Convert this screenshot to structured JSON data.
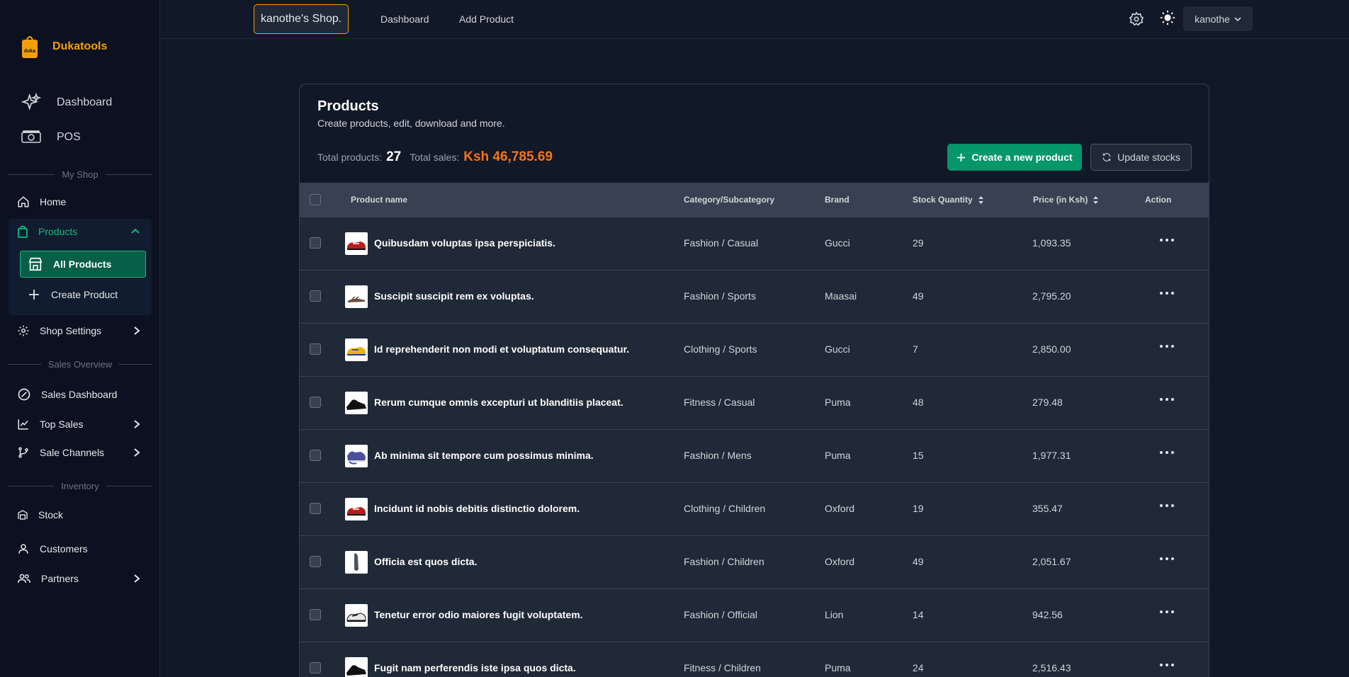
{
  "sidebar": {
    "brand": "Dukatools",
    "brand_logo_text": "duka",
    "nav_top": [
      {
        "label": "Dashboard",
        "icon": "sparkles-icon"
      },
      {
        "label": "POS",
        "icon": "cash-icon"
      }
    ],
    "sections": {
      "my_shop": "My Shop",
      "sales_overview": "Sales Overview",
      "inventory": "Inventory"
    },
    "home": "Home",
    "products": "Products",
    "all_products": "All Products",
    "create_product": "Create Product",
    "shop_settings": "Shop Settings",
    "sales_dashboard": "Sales Dashboard",
    "top_sales": "Top Sales",
    "sale_channels": "Sale Channels",
    "stock": "Stock",
    "customers": "Customers",
    "partners": "Partners"
  },
  "topbar": {
    "shop_name": "kanothe's Shop.",
    "links": [
      "Dashboard",
      "Add Product"
    ],
    "user": "kanothe"
  },
  "products": {
    "title": "Products",
    "subtitle": "Create products, edit, download and more.",
    "total_products_label": "Total products:",
    "total_products": "27",
    "total_sales_label": "Total sales:",
    "total_sales": "Ksh 46,785.69",
    "create_button": "Create a new product",
    "update_button": "Update stocks",
    "columns": [
      "Product name",
      "Category/Subcategory",
      "Brand",
      "Stock Quantity",
      "Price (in Ksh)",
      "Action"
    ],
    "rows": [
      {
        "name": "Quibusdam voluptas ipsa perspiciatis.",
        "category": "Fashion / Casual",
        "brand": "Gucci",
        "stock": "29",
        "price": "1,093.35",
        "thumb": "sneaker-red"
      },
      {
        "name": "Suscipit suscipit rem ex voluptas.",
        "category": "Fashion / Sports",
        "brand": "Maasai",
        "stock": "49",
        "price": "2,795.20",
        "thumb": "sandal"
      },
      {
        "name": "Id reprehenderit non modi et voluptatum consequatur.",
        "category": "Clothing / Sports",
        "brand": "Gucci",
        "stock": "7",
        "price": "2,850.00",
        "thumb": "sneaker-yellow"
      },
      {
        "name": "Rerum cumque omnis excepturi ut blanditiis placeat.",
        "category": "Fitness / Casual",
        "brand": "Puma",
        "stock": "48",
        "price": "279.48",
        "thumb": "shoe-black"
      },
      {
        "name": "Ab minima sit tempore cum possimus minima.",
        "category": "Fashion / Mens",
        "brand": "Puma",
        "stock": "15",
        "price": "1,977.31",
        "thumb": "shoe-blue"
      },
      {
        "name": "Incidunt id nobis debitis distinctio dolorem.",
        "category": "Clothing / Children",
        "brand": "Oxford",
        "stock": "19",
        "price": "355.47",
        "thumb": "sneaker-red"
      },
      {
        "name": "Officia est quos dicta.",
        "category": "Fashion / Children",
        "brand": "Oxford",
        "stock": "49",
        "price": "2,051.67",
        "thumb": "shoe-grey"
      },
      {
        "name": "Tenetur error odio maiores fugit voluptatem.",
        "category": "Fashion / Official",
        "brand": "Lion",
        "stock": "14",
        "price": "942.56",
        "thumb": "sneaker-white"
      },
      {
        "name": "Fugit nam perferendis iste ipsa quos dicta.",
        "category": "Fitness / Children",
        "brand": "Puma",
        "stock": "24",
        "price": "2,516.43",
        "thumb": "shoe-black"
      }
    ]
  },
  "colors": {
    "accent": "#10b981",
    "brand": "#f59e0b",
    "sales": "#f97316",
    "background": "#111827"
  }
}
